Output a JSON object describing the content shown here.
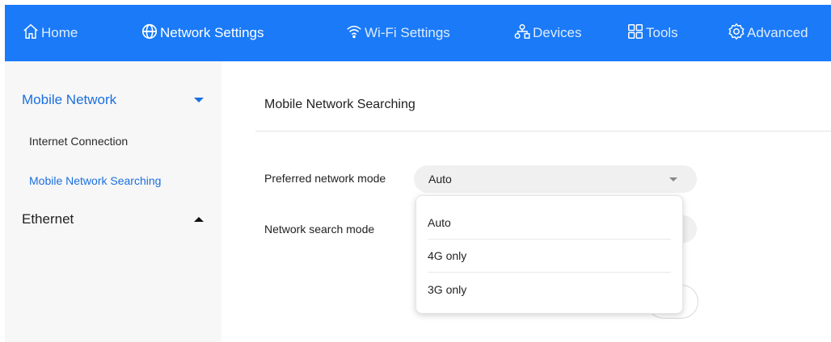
{
  "nav": {
    "items": [
      {
        "label": "Home",
        "icon": "home-icon"
      },
      {
        "label": "Network Settings",
        "icon": "globe-icon"
      },
      {
        "label": "Wi-Fi Settings",
        "icon": "wifi-icon"
      },
      {
        "label": "Devices",
        "icon": "devices-icon"
      },
      {
        "label": "Tools",
        "icon": "tools-icon"
      },
      {
        "label": "Advanced",
        "icon": "gear-icon"
      }
    ],
    "active": "Network Settings",
    "bg_color": "#1a7af8"
  },
  "sidebar": {
    "mobile_network": {
      "label": "Mobile Network",
      "expanded": true,
      "items": [
        {
          "label": "Internet Connection"
        },
        {
          "label": "Mobile Network Searching"
        }
      ]
    },
    "ethernet": {
      "label": "Ethernet",
      "expanded": false
    }
  },
  "main": {
    "title": "Mobile Network Searching",
    "preferred_mode": {
      "label": "Preferred network mode",
      "value": "Auto"
    },
    "search_mode": {
      "label": "Network search mode"
    },
    "dropdown": {
      "options": [
        "Auto",
        "4G only",
        "3G only"
      ]
    }
  },
  "colors": {
    "accent": "#1a7af8",
    "link_blue": "#1a6fdf"
  }
}
